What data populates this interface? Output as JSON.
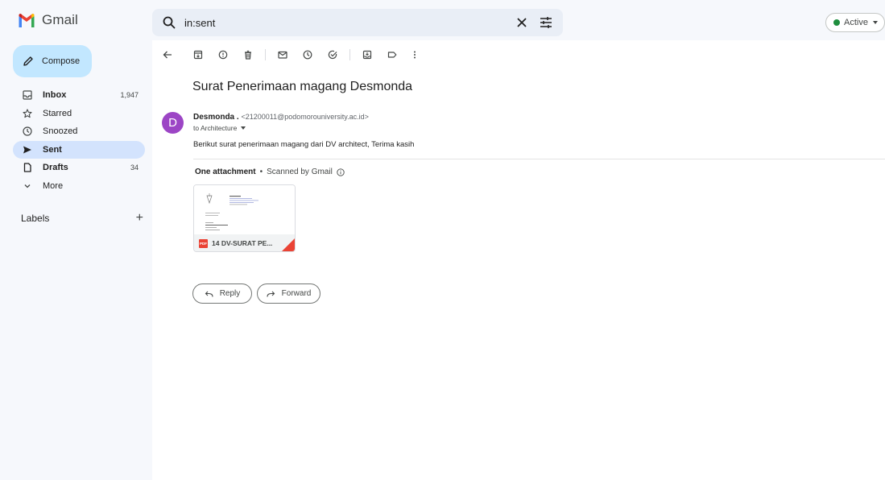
{
  "app": {
    "name": "Gmail"
  },
  "search": {
    "value": "in:sent"
  },
  "status": {
    "label": "Active",
    "color": "#1e8e3e"
  },
  "sidebar": {
    "compose_label": "Compose",
    "items": [
      {
        "label": "Inbox",
        "count": "1,947"
      },
      {
        "label": "Starred",
        "count": ""
      },
      {
        "label": "Snoozed",
        "count": ""
      },
      {
        "label": "Sent",
        "count": ""
      },
      {
        "label": "Drafts",
        "count": "34"
      },
      {
        "label": "More",
        "count": ""
      }
    ],
    "labels_heading": "Labels"
  },
  "email": {
    "subject": "Surat Penerimaan magang Desmonda",
    "avatar_letter": "D",
    "avatar_color": "#9c45c5",
    "sender_name": "Desmonda .",
    "sender_email": "<21200011@podomorouniversity.ac.id>",
    "to_line": "to Architecture",
    "body": "Berikut surat penerimaan magang dari DV architect, Terima kasih",
    "attachment_heading": "One attachment",
    "scan_note": "Scanned by Gmail",
    "attachment_name": "14 DV-SURAT PE...",
    "attachment_type": "PDF"
  },
  "actions": {
    "reply": "Reply",
    "forward": "Forward"
  },
  "colors": {
    "compose_bg": "#c2e7ff",
    "selected_bg": "#d3e3fd",
    "pdf_red": "#ea4335"
  }
}
